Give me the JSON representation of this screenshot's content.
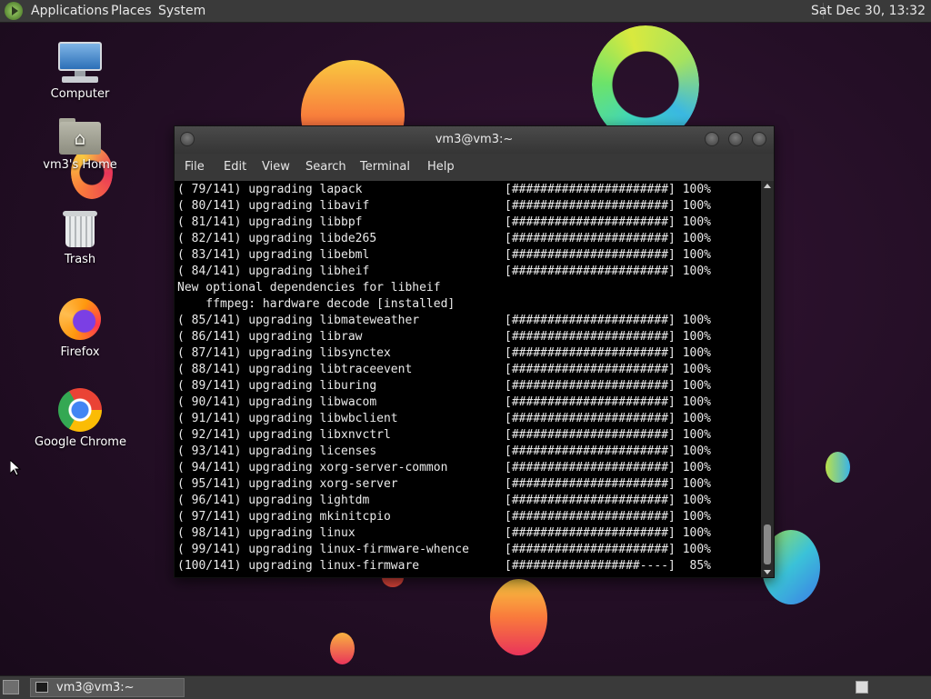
{
  "top_panel": {
    "menus": [
      "Applications",
      "Places",
      "System"
    ],
    "clock": "Sat Dec 30, 13:32"
  },
  "desktop_icons": [
    {
      "label": "Computer",
      "icon": "computer-icon"
    },
    {
      "label": "vm3's Home",
      "icon": "home-folder-icon"
    },
    {
      "label": "Trash",
      "icon": "trash-icon"
    },
    {
      "label": "Firefox",
      "icon": "firefox-icon"
    },
    {
      "label": "Google Chrome",
      "icon": "chrome-icon"
    }
  ],
  "terminal": {
    "title": "vm3@vm3:~",
    "menu": [
      "File",
      "Edit",
      "View",
      "Search",
      "Terminal",
      "Help"
    ],
    "lines": [
      "( 79/141) upgrading lapack                    [######################] 100%",
      "( 80/141) upgrading libavif                   [######################] 100%",
      "( 81/141) upgrading libbpf                    [######################] 100%",
      "( 82/141) upgrading libde265                  [######################] 100%",
      "( 83/141) upgrading libebml                   [######################] 100%",
      "( 84/141) upgrading libheif                   [######################] 100%",
      "New optional dependencies for libheif",
      "    ffmpeg: hardware decode [installed]",
      "( 85/141) upgrading libmateweather            [######################] 100%",
      "( 86/141) upgrading libraw                    [######################] 100%",
      "( 87/141) upgrading libsynctex                [######################] 100%",
      "( 88/141) upgrading libtraceevent             [######################] 100%",
      "( 89/141) upgrading liburing                  [######################] 100%",
      "( 90/141) upgrading libwacom                  [######################] 100%",
      "( 91/141) upgrading libwbclient               [######################] 100%",
      "( 92/141) upgrading libxnvctrl                [######################] 100%",
      "( 93/141) upgrading licenses                  [######################] 100%",
      "( 94/141) upgrading xorg-server-common        [######################] 100%",
      "( 95/141) upgrading xorg-server               [######################] 100%",
      "( 96/141) upgrading lightdm                   [######################] 100%",
      "( 97/141) upgrading mkinitcpio                [######################] 100%",
      "( 98/141) upgrading linux                     [######################] 100%",
      "( 99/141) upgrading linux-firmware-whence     [######################] 100%",
      "(100/141) upgrading linux-firmware            [##################----]  85%"
    ]
  },
  "taskbar": {
    "task_label": "vm3@vm3:~"
  }
}
